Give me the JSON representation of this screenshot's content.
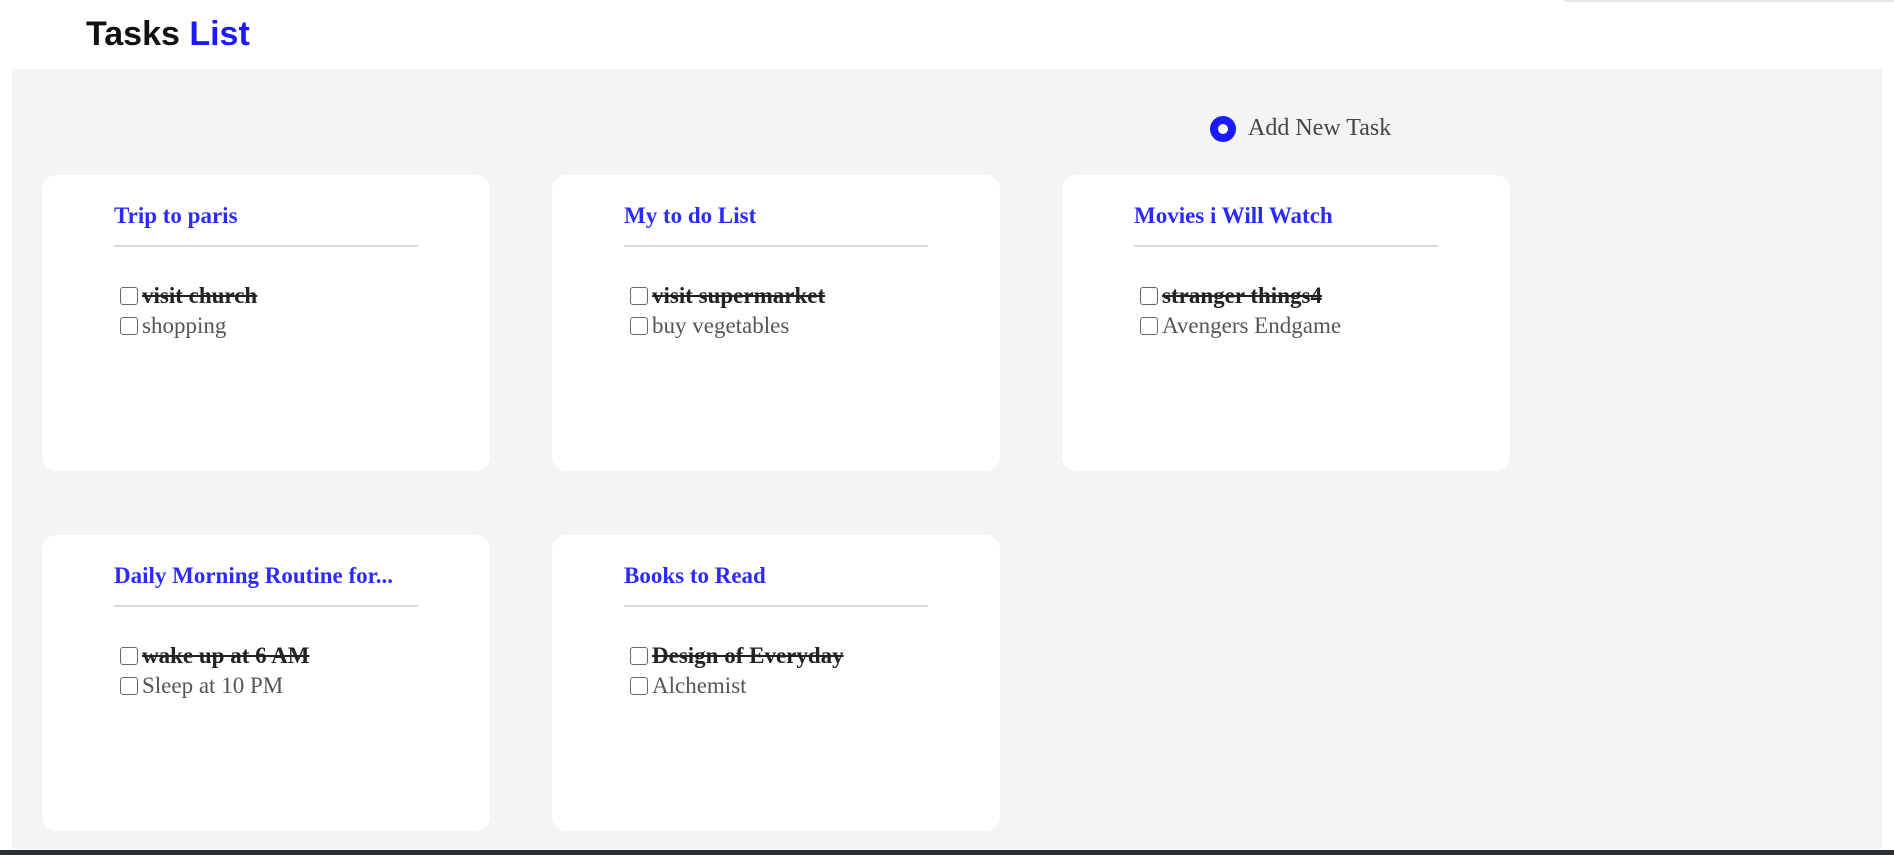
{
  "header": {
    "title_main": "Tasks",
    "title_accent": "List"
  },
  "toolbar": {
    "add_label": "Add New Task"
  },
  "cards": [
    {
      "title": "Trip to paris",
      "tasks": [
        {
          "text": "visit church",
          "done": true
        },
        {
          "text": "shopping",
          "done": false
        }
      ]
    },
    {
      "title": "My to do List",
      "tasks": [
        {
          "text": "visit supermarket",
          "done": true
        },
        {
          "text": "buy vegetables",
          "done": false
        }
      ]
    },
    {
      "title": "Movies i Will Watch",
      "tasks": [
        {
          "text": "stranger things4",
          "done": true
        },
        {
          "text": "Avengers Endgame",
          "done": false
        }
      ]
    },
    {
      "title": "Daily Morning Routine for...",
      "tasks": [
        {
          "text": "wake up at 6 AM",
          "done": true
        },
        {
          "text": "Sleep at 10 PM",
          "done": false
        }
      ]
    },
    {
      "title": "Books to Read",
      "tasks": [
        {
          "text": "Design of Everyday",
          "done": true
        },
        {
          "text": "Alchemist",
          "done": false
        }
      ]
    }
  ],
  "colors": {
    "accent": "#1a1aff",
    "card_title": "#2b2bff",
    "board_bg": "#f4f4f4"
  },
  "icons": {
    "add": "plus-circle-icon"
  }
}
